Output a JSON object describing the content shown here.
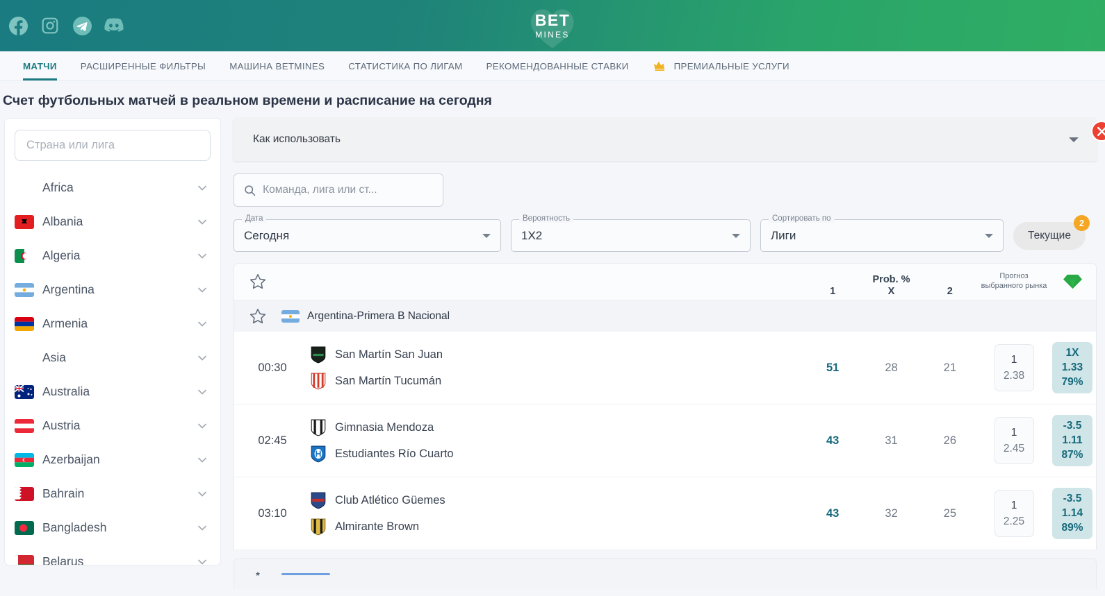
{
  "header": {
    "social": [
      {
        "name": "facebook-icon",
        "label": "Facebook"
      },
      {
        "name": "instagram-icon",
        "label": "Instagram"
      },
      {
        "name": "telegram-icon",
        "label": "Telegram"
      },
      {
        "name": "discord-icon",
        "label": "Discord"
      }
    ],
    "logo_primary": "BET",
    "logo_secondary": "MINES",
    "brand_gradient_start": "#1a7b80",
    "brand_gradient_end": "#2fae63"
  },
  "nav": {
    "tabs": [
      {
        "label": "МАТЧИ",
        "active": true,
        "icon": null
      },
      {
        "label": "РАСШИРЕННЫЕ ФИЛЬТРЫ",
        "active": false,
        "icon": null
      },
      {
        "label": "МАШИНА BETMINES",
        "active": false,
        "icon": null
      },
      {
        "label": "СТАТИСТИКА ПО ЛИГАМ",
        "active": false,
        "icon": null
      },
      {
        "label": "РЕКОМЕНДОВАННЫЕ СТАВКИ",
        "active": false,
        "icon": null
      },
      {
        "label": "ПРЕМИАЛЬНЫЕ УСЛУГИ",
        "active": false,
        "icon": "crown-icon"
      }
    ],
    "active_color": "#1a7b80"
  },
  "page": {
    "title": "Счет футбольных матчей в реальном времени и расписание на сегодня"
  },
  "sidebar": {
    "search_placeholder": "Страна или лига",
    "items": [
      {
        "label": "Africa",
        "flag": null,
        "type": "region"
      },
      {
        "label": "Albania",
        "flag": "al",
        "type": "country"
      },
      {
        "label": "Algeria",
        "flag": "dz",
        "type": "country"
      },
      {
        "label": "Argentina",
        "flag": "ar",
        "type": "country"
      },
      {
        "label": "Armenia",
        "flag": "am",
        "type": "country"
      },
      {
        "label": "Asia",
        "flag": null,
        "type": "region"
      },
      {
        "label": "Australia",
        "flag": "au",
        "type": "country"
      },
      {
        "label": "Austria",
        "flag": "at",
        "type": "country"
      },
      {
        "label": "Azerbaijan",
        "flag": "az",
        "type": "country"
      },
      {
        "label": "Bahrain",
        "flag": "bh",
        "type": "country"
      },
      {
        "label": "Bangladesh",
        "flag": "bd",
        "type": "country"
      },
      {
        "label": "Belarus",
        "flag": "by",
        "type": "country"
      }
    ]
  },
  "main": {
    "howto_label": "Как использовать",
    "search_placeholder": "Команда, лига или ст...",
    "filters": [
      {
        "legend": "Дата",
        "value": "Сегодня"
      },
      {
        "legend": "Вероятность",
        "value": "1X2"
      },
      {
        "legend": "Сортировать по",
        "value": "Лиги"
      }
    ],
    "current_button": {
      "label": "Текущие",
      "badge": "2",
      "badge_color": "#f5a623"
    },
    "close_button": {
      "label": "×",
      "color": "#ec4131"
    }
  },
  "table": {
    "prob_group_title": "Prob. %",
    "prob_columns": [
      "1",
      "X",
      "2"
    ],
    "forecast_header": "Прогноз выбранного рынка",
    "gem_icon": "diamond-icon",
    "gem_color": "#2db34a",
    "leagues": [
      {
        "name": "Argentina-Primera B Nacional",
        "flag": "ar",
        "matches": [
          {
            "time": "00:30",
            "home": "San Martín San Juan",
            "away": "San Martín Tucumán",
            "home_crest": "crest-dark-green",
            "away_crest": "crest-red-stripes",
            "prob_1": "51",
            "prob_x": "28",
            "prob_2": "21",
            "prob_highlight": "1",
            "odds_label": "1",
            "odds_value": "2.38",
            "pick_market": "1X",
            "pick_odds": "1.33",
            "pick_prob": "79%"
          },
          {
            "time": "02:45",
            "home": "Gimnasia Mendoza",
            "away": "Estudiantes Río Cuarto",
            "home_crest": "crest-black-white",
            "away_crest": "crest-blue",
            "prob_1": "43",
            "prob_x": "31",
            "prob_2": "26",
            "prob_highlight": "1",
            "odds_label": "1",
            "odds_value": "2.45",
            "pick_market": "-3.5",
            "pick_odds": "1.11",
            "pick_prob": "87%"
          },
          {
            "time": "03:10",
            "home": "Club Atlético Güemes",
            "away": "Almirante Brown",
            "home_crest": "crest-navy-red",
            "away_crest": "crest-yellow-black",
            "prob_1": "43",
            "prob_x": "32",
            "prob_2": "25",
            "prob_highlight": "1",
            "odds_label": "1",
            "odds_value": "2.25",
            "pick_market": "-3.5",
            "pick_odds": "1.14",
            "pick_prob": "89%"
          }
        ]
      }
    ]
  }
}
